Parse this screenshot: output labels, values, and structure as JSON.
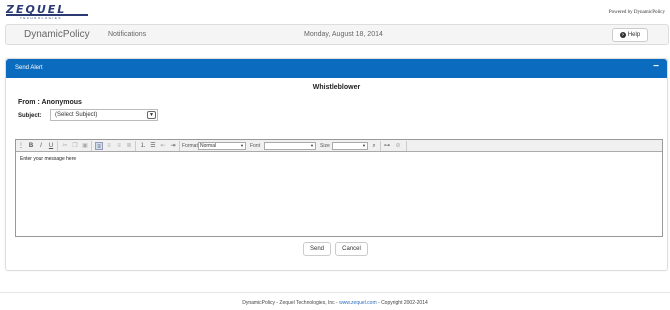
{
  "header": {
    "logo_text": "ZEQUEL",
    "logo_sub": "TECHNOLOGIES",
    "powered_by": "Powered by DynamicPolicy"
  },
  "navbar": {
    "brand": "DynamicPolicy",
    "notifications": "Notifications",
    "date": "Monday, August 18, 2014",
    "help": "Help"
  },
  "panel": {
    "title": "Send Alert",
    "collapse_icon": "minus-icon",
    "form_title": "Whistleblower",
    "from": "From : Anonymous",
    "subject_label": "Subject:",
    "subject_value": "(Select Subject)"
  },
  "editor": {
    "format_label": "Format",
    "format_value": "Normal",
    "font_label": "Font",
    "font_value": "",
    "size_label": "Size",
    "size_value": "",
    "placeholder": "Enter your message here"
  },
  "buttons": {
    "send": "Send",
    "cancel": "Cancel"
  },
  "footer": {
    "prefix": "DynamicPolicy - Zequel Technologies, Inc - ",
    "link": "www.zequel.com",
    "suffix": " - Copyright 2002-2014"
  }
}
